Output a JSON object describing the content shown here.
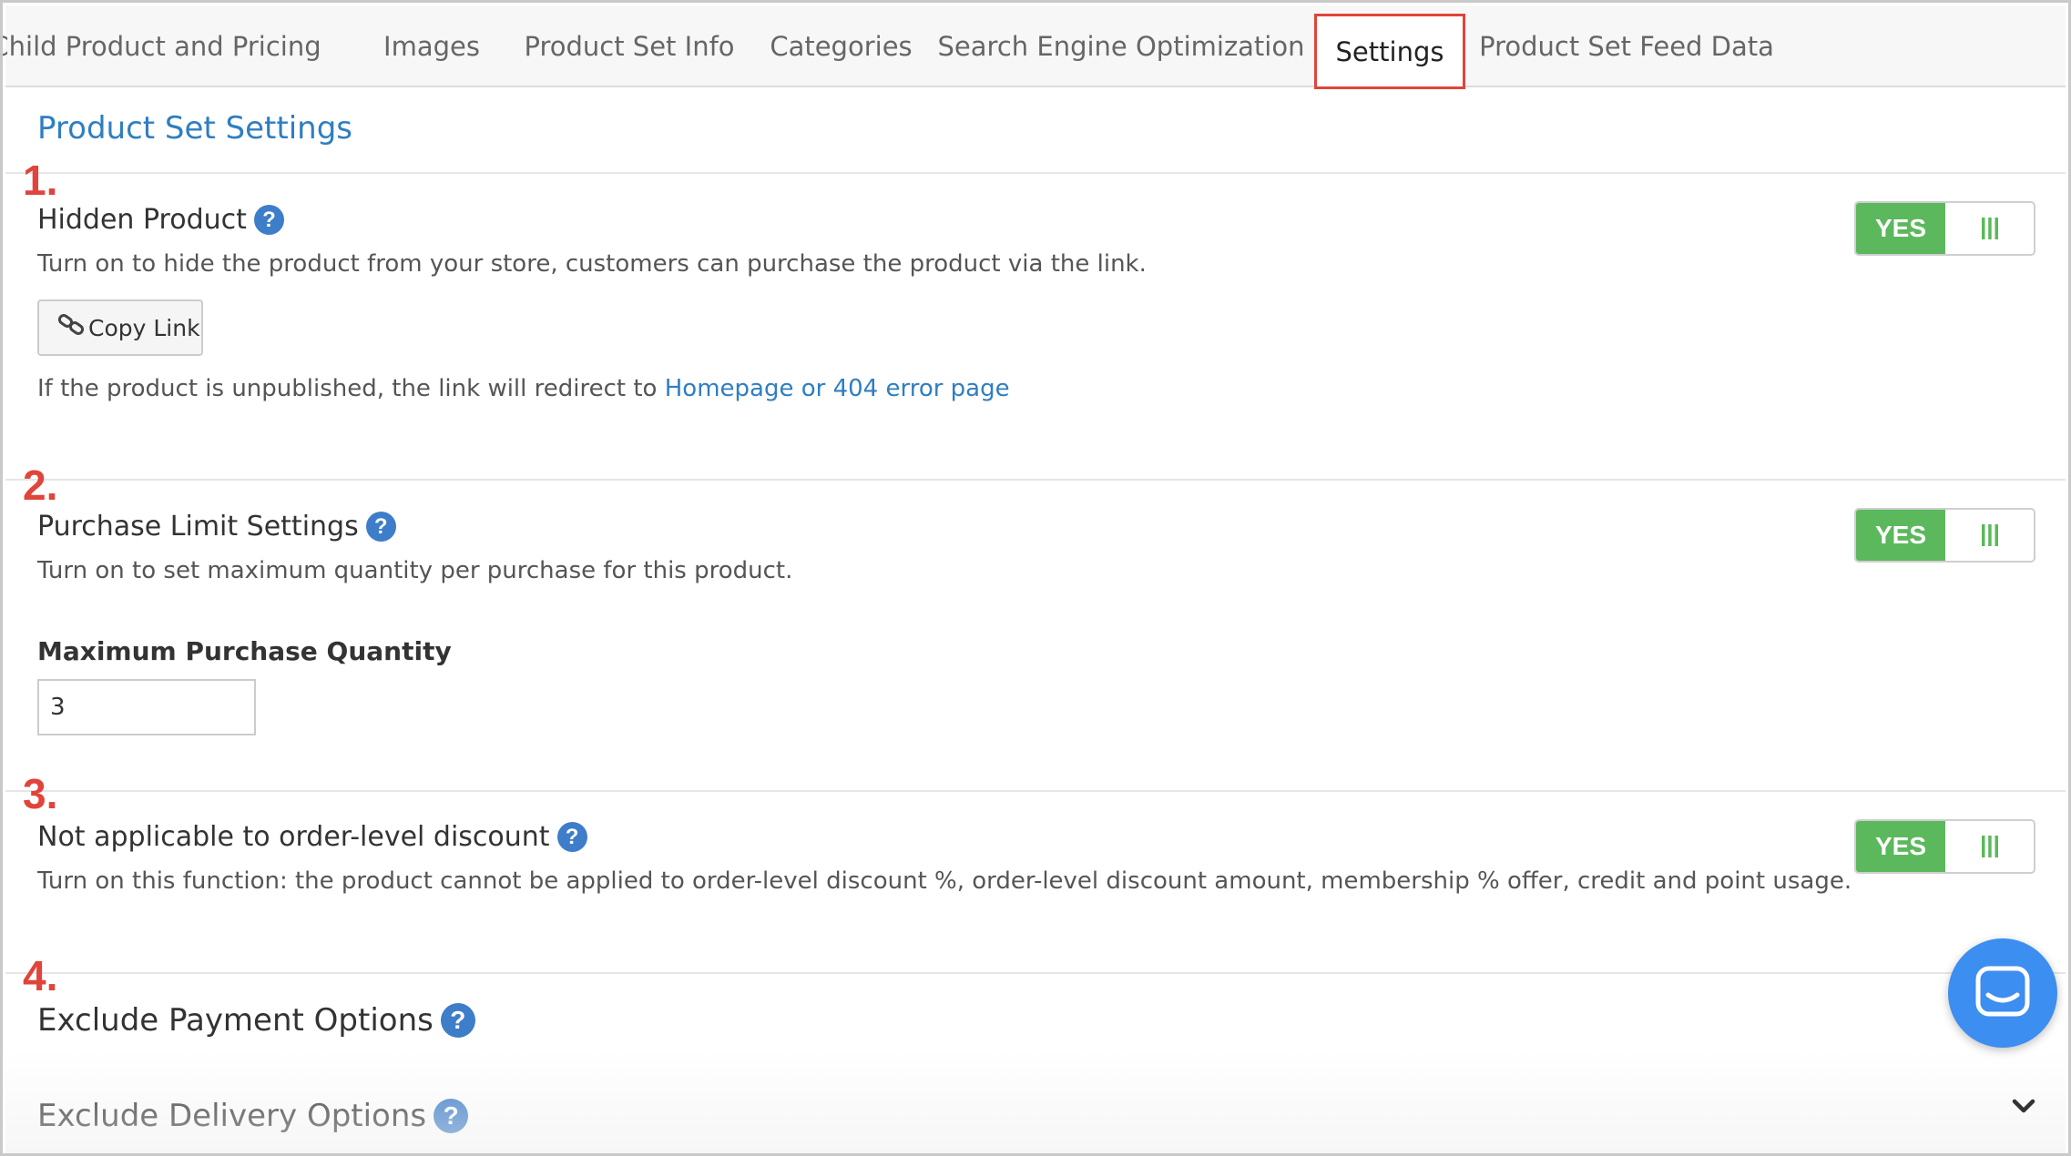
{
  "tabs": [
    {
      "label": "Child Product and Pricing"
    },
    {
      "label": "Images"
    },
    {
      "label": "Product Set Info"
    },
    {
      "label": "Categories"
    },
    {
      "label": "Search Engine Optimization"
    },
    {
      "label": "Settings",
      "active": true
    },
    {
      "label": "Product Set Feed Data"
    }
  ],
  "section_title": "Product Set Settings",
  "sections": [
    {
      "number": "1.",
      "title": "Hidden Product",
      "help": "?",
      "description": "Turn on to hide the product from your store, customers can purchase the product via the link.",
      "toggle": {
        "label": "YES",
        "state": "on"
      },
      "copy_link_label": "Copy Link",
      "note_prefix": "If the product is unpublished, the link will redirect to ",
      "note_link": "Homepage or 404 error page"
    },
    {
      "number": "2.",
      "title": "Purchase Limit Settings",
      "help": "?",
      "description": "Turn on to set maximum quantity per purchase for this product.",
      "toggle": {
        "label": "YES",
        "state": "on"
      },
      "field_label": "Maximum Purchase Quantity",
      "field_value": "3"
    },
    {
      "number": "3.",
      "title": "Not applicable to order-level discount",
      "help": "?",
      "description": "Turn on this function: the product cannot be applied to order-level discount %, order-level discount amount, membership % offer, credit and point usage.",
      "toggle": {
        "label": "YES",
        "state": "on"
      }
    },
    {
      "number": "4.",
      "title": "Exclude Payment Options",
      "help": "?"
    }
  ],
  "exclude_delivery": {
    "title": "Exclude Delivery Options",
    "help": "?"
  },
  "icons": {
    "help": "question-circle-icon",
    "copy": "link-icon",
    "toggle_handle": "grip-lines-icon",
    "chat": "chat-bubble-icon",
    "expand": "chevron-down-icon"
  },
  "colors": {
    "accent_blue": "#2f7ec1",
    "toggle_green": "#5cb85c",
    "highlight_red": "#e0443a",
    "chat_blue": "#3c8ef0"
  }
}
